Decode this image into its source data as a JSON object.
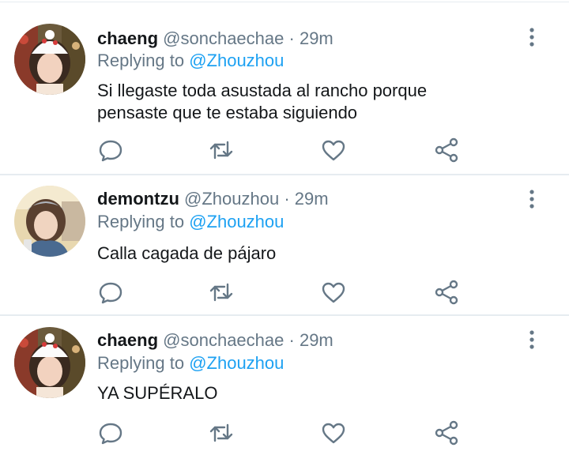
{
  "colors": {
    "accent": "#1da1f2",
    "secondary_text": "#657786",
    "primary_text": "#14171a",
    "divider": "#e6ecf0"
  },
  "tweets": [
    {
      "name": "chaeng",
      "handle": "@sonchaechae",
      "separator": "·",
      "time": "29m",
      "replying_prefix": "Replying to",
      "replying_to": "@Zhouzhou",
      "text_lines": [
        "Si llegaste toda asustada al rancho porque",
        "pensaste que te estaba siguiendo"
      ],
      "actions": [
        "reply-icon",
        "retweet-icon",
        "like-icon",
        "share-icon"
      ]
    },
    {
      "name": "demontzu",
      "handle": "@Zhouzhou",
      "separator": "·",
      "time": "29m",
      "replying_prefix": "Replying to",
      "replying_to": "@Zhouzhou",
      "text_lines": [
        "Calla cagada de pájaro"
      ],
      "actions": [
        "reply-icon",
        "retweet-icon",
        "like-icon",
        "share-icon"
      ]
    },
    {
      "name": "chaeng",
      "handle": "@sonchaechae",
      "separator": "·",
      "time": "29m",
      "replying_prefix": "Replying to",
      "replying_to": "@Zhouzhou",
      "text_lines": [
        "YA SUPÉRALO"
      ],
      "actions": [
        "reply-icon",
        "retweet-icon",
        "like-icon",
        "share-icon"
      ]
    }
  ]
}
